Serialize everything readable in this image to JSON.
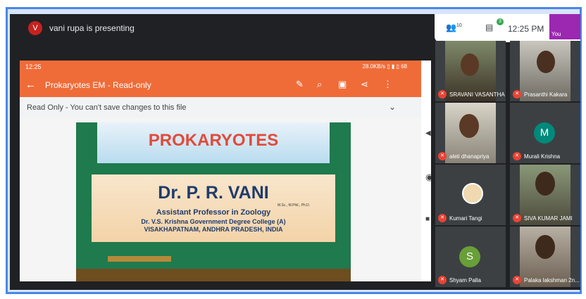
{
  "meeting": {
    "presenter_initial": "V",
    "presenting_text": "vani rupa is presenting",
    "participants_count": "10",
    "chat_badge": "3",
    "time": "12:25 PM",
    "self_label": "You"
  },
  "phone": {
    "status_time": "12:25",
    "status_net": "28.0KB/s",
    "battery": "68",
    "doc_title": "Prokaryotes EM - Read-only",
    "readonly_banner": "Read Only - You can't save changes to this file"
  },
  "slide": {
    "title": "PROKARYOTES",
    "name": "Dr. P. R. VANI",
    "qualifications": "M.Sc., M.Phil., Ph.D.",
    "role": "Assistant Professor in Zoology",
    "college": "Dr. V.S. Krishna Government Degree College (A)",
    "place": "VISAKHAPATNAM, ANDHRA PRADESH, INDIA"
  },
  "participants": [
    {
      "name": "SRAVANI VASANTHA",
      "type": "video"
    },
    {
      "name": "Prasanthi Kakara",
      "type": "video"
    },
    {
      "name": "aleti dhanapriya",
      "type": "video"
    },
    {
      "name": "Murali Krishna",
      "type": "letter",
      "letter": "M",
      "color": "#00897b"
    },
    {
      "name": "Kumari Tangi",
      "type": "video"
    },
    {
      "name": "SIVA KUMAR JAMI",
      "type": "video"
    },
    {
      "name": "Shyam Palla",
      "type": "letter",
      "letter": "S",
      "color": "#689f38"
    },
    {
      "name": "Palaka lakshman 2n...",
      "type": "video"
    }
  ],
  "icons": [
    "people-icon",
    "chat-icon",
    "mute-icon",
    "back-arrow-icon",
    "edit-icon",
    "search-icon",
    "present-icon",
    "share-icon",
    "more-icon",
    "chevron-down-icon"
  ]
}
